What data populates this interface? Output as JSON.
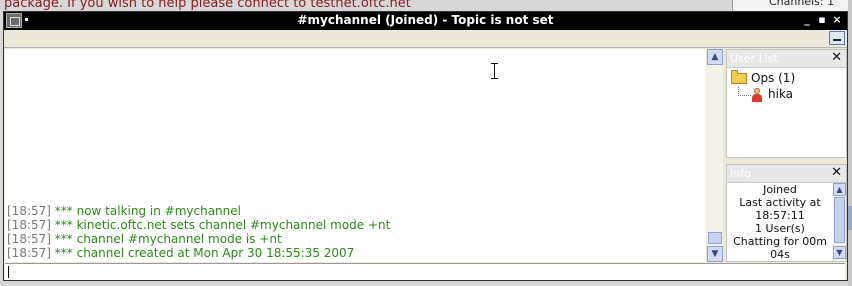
{
  "background": {
    "notice_text": "package. If you wish to help please connect to testnet.oftc.net",
    "right_panel_text": "Channels: 1"
  },
  "window": {
    "title": "#mychannel (Joined) - Topic is not set",
    "controls": {
      "minimize": "_",
      "restore": "▪",
      "close": "×"
    }
  },
  "chat": {
    "lines": [
      {
        "time": "[18:57]",
        "text": "*** now talking in #mychannel"
      },
      {
        "time": "[18:57]",
        "text": "*** kinetic.oftc.net sets channel #mychannel mode +nt"
      },
      {
        "time": "[18:57]",
        "text": "*** channel #mychannel mode is +nt"
      },
      {
        "time": "[18:57]",
        "text": "*** channel created at Mon Apr 30 18:55:35 2007"
      }
    ]
  },
  "user_list": {
    "title": "User List",
    "close": "✕",
    "group_label": "Ops (1)",
    "users": [
      "hika"
    ]
  },
  "info": {
    "title": "Info",
    "close": "✕",
    "lines": [
      "Joined",
      "Last activity at",
      "18:57:11",
      "1 User(s)",
      "Chatting for 00m",
      "04s"
    ]
  },
  "input": {
    "value": ""
  }
}
